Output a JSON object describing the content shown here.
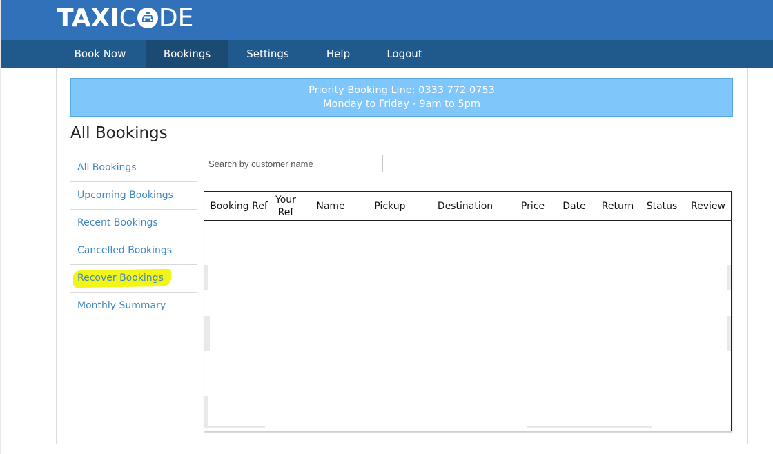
{
  "brand": {
    "logo_bold": "TAXI",
    "logo_light_pre": "C",
    "logo_light_post": "DE"
  },
  "nav": {
    "items": [
      {
        "label": "Book Now"
      },
      {
        "label": "Bookings"
      },
      {
        "label": "Settings"
      },
      {
        "label": "Help"
      },
      {
        "label": "Logout"
      }
    ],
    "active": "Bookings"
  },
  "banner": {
    "line1": "Priority Booking Line: 0333 772 0753",
    "line2": "Monday to Friday - 9am to 5pm"
  },
  "page_title": "All Bookings",
  "sidebar": {
    "items": [
      {
        "label": "All Bookings"
      },
      {
        "label": "Upcoming Bookings"
      },
      {
        "label": "Recent Bookings"
      },
      {
        "label": "Cancelled Bookings"
      },
      {
        "label": "Recover Bookings",
        "highlighted": true
      },
      {
        "label": "Monthly Summary"
      }
    ]
  },
  "search": {
    "placeholder": "Search by customer name",
    "value": ""
  },
  "table": {
    "columns": [
      "Booking Ref",
      "Your Ref",
      "Name",
      "Pickup",
      "Destination",
      "Price",
      "Date",
      "Return",
      "Status",
      "Review"
    ],
    "rows": []
  },
  "colors": {
    "header": "#3071b9",
    "nav": "#205a8c",
    "nav_active": "#1b4a72",
    "banner": "#7fc6fb",
    "link": "#3e86c4",
    "highlight": "#f2f516"
  },
  "icons": {
    "logo_o": "taxi-car-icon"
  }
}
